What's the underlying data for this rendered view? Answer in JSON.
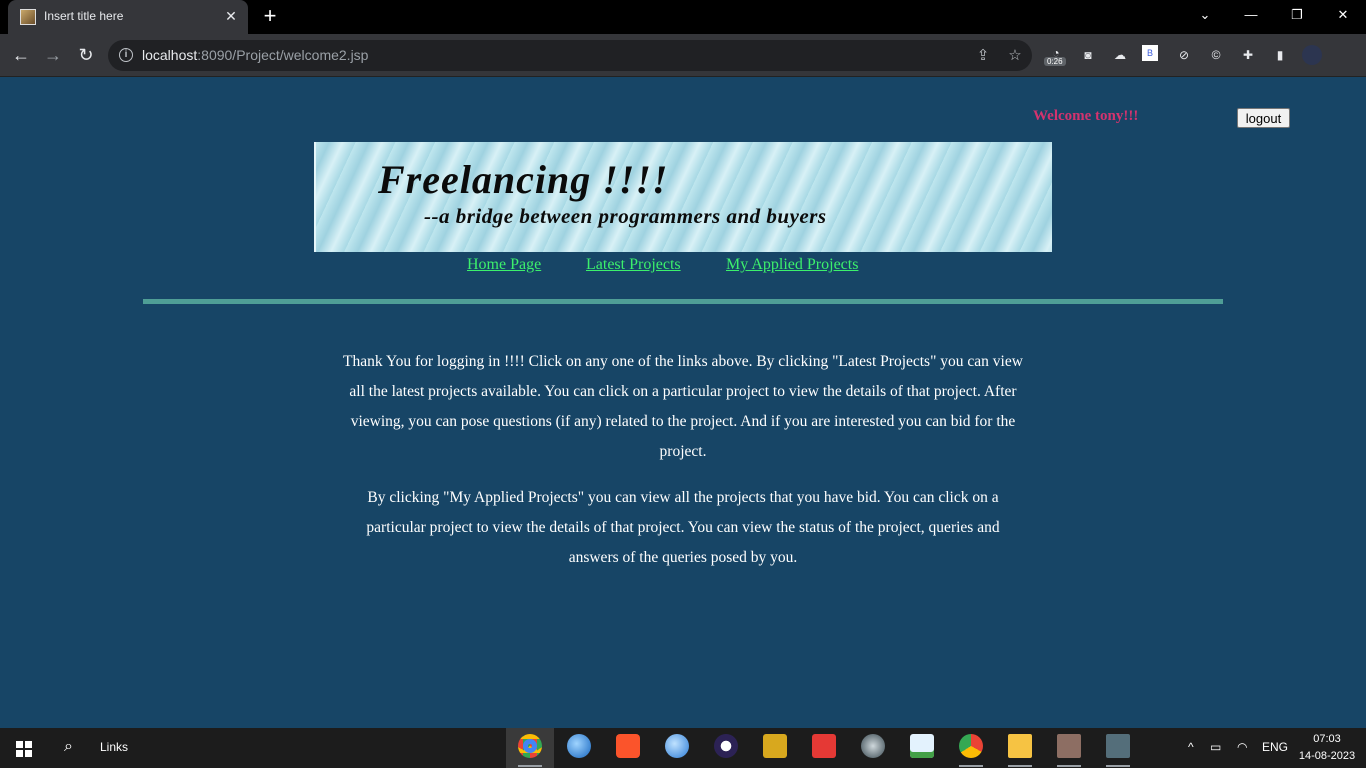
{
  "browser": {
    "tab_title": "Insert title here",
    "new_tab_symbol": "+",
    "close_symbol": "✕",
    "url_host": "localhost",
    "url_path": ":8090/Project/welcome2.jsp",
    "ext_badge": "0:26",
    "window_controls": [
      "⌄",
      "—",
      "❐",
      "✕"
    ]
  },
  "header": {
    "welcome_text": "Welcome tony!!!",
    "logout_label": "logout"
  },
  "banner": {
    "title": "Freelancing !!!!",
    "subtitle": "--a bridge between programmers and buyers"
  },
  "nav": {
    "links": [
      "Home Page",
      "Latest Projects",
      "My Applied Projects"
    ]
  },
  "content": {
    "paragraph1": "Thank You for logging in !!!! Click on any one of the links above. By clicking \"Latest Projects\" you can view all the latest projects available. You can click on a particular project to view the details of that project. After viewing, you can pose questions (if any) related to the project. And if you are interested you can bid for the project.",
    "paragraph2": "By clicking \"My Applied Projects\" you can view all the projects that you have bid. You can click on a particular project to view the details of that project. You can view the status of the project, queries and answers of the queries posed by you."
  },
  "taskbar": {
    "links_label": "Links",
    "language": "ENG",
    "time": "07:03",
    "date": "14-08-2023"
  },
  "colors": {
    "page_bg": "#174566",
    "welcome": "#d4336e",
    "link": "#3cf06c",
    "divider": "#4f9e96"
  }
}
